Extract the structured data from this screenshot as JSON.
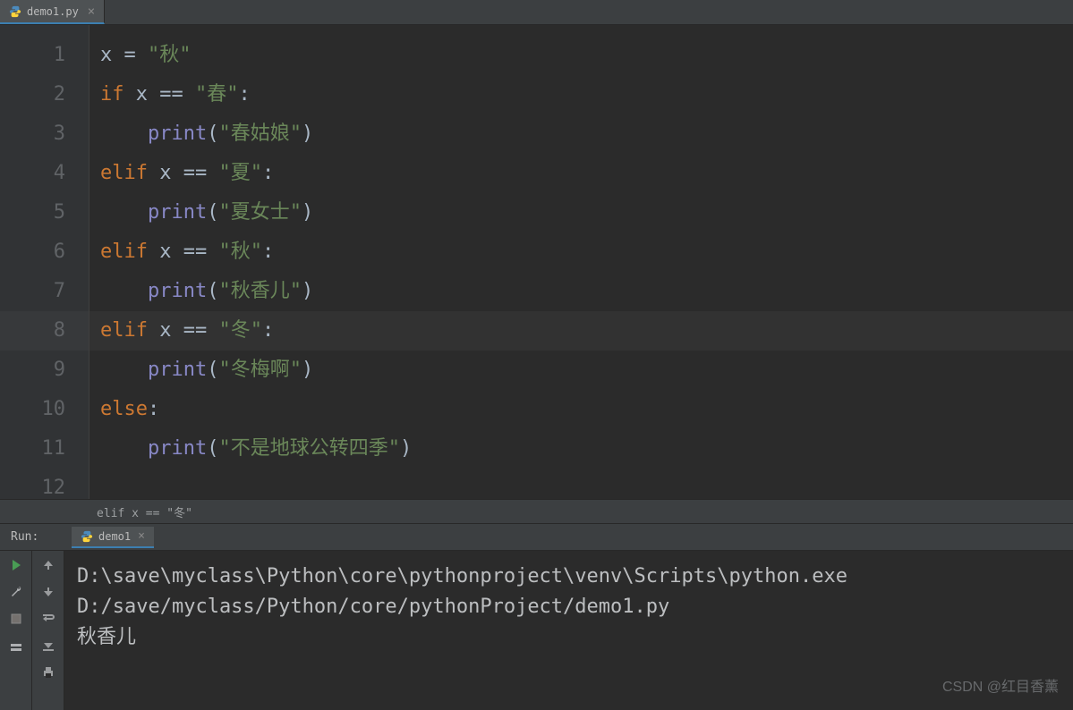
{
  "tab": {
    "filename": "demo1.py"
  },
  "gutter": [
    "1",
    "2",
    "3",
    "4",
    "5",
    "6",
    "7",
    "8",
    "9",
    "10",
    "11",
    "12"
  ],
  "code": {
    "l1": {
      "id1": "x",
      "op": " = ",
      "str": "\"秋\""
    },
    "l2": {
      "kw": "if",
      "id": " x ",
      "op": "==",
      "sp": " ",
      "str": "\"春\"",
      "col": ":"
    },
    "l3": {
      "pad": "    ",
      "fn": "print",
      "lp": "(",
      "str": "\"春姑娘\"",
      "rp": ")"
    },
    "l4": {
      "kw": "elif",
      "id": " x ",
      "op": "==",
      "sp": " ",
      "str": "\"夏\"",
      "col": ":"
    },
    "l5": {
      "pad": "    ",
      "fn": "print",
      "lp": "(",
      "str": "\"夏女士\"",
      "rp": ")"
    },
    "l6": {
      "kw": "elif",
      "id": " x ",
      "op": "==",
      "sp": " ",
      "str": "\"秋\"",
      "col": ":"
    },
    "l7": {
      "pad": "    ",
      "fn": "print",
      "lp": "(",
      "str": "\"秋香儿\"",
      "rp": ")"
    },
    "l8": {
      "kw": "elif",
      "id": " x ",
      "op": "==",
      "sp": " ",
      "str": "\"冬\"",
      "col": ":"
    },
    "l9": {
      "pad": "    ",
      "fn": "print",
      "lp": "(",
      "str": "\"冬梅啊\"",
      "rp": ")"
    },
    "l10": {
      "kw": "else",
      "col": ":"
    },
    "l11": {
      "pad": "    ",
      "fn": "print",
      "lp": "(",
      "str": "\"不是地球公转四季\"",
      "rp": ")"
    }
  },
  "crumb": "elif x == \"冬\"",
  "run": {
    "label": "Run:",
    "tab_name": "demo1"
  },
  "console": {
    "line1": "D:\\save\\myclass\\Python\\core\\pythonproject\\venv\\Scripts\\python.exe",
    "line2": " D:/save/myclass/Python/core/pythonProject/demo1.py",
    "line3": "秋香儿"
  },
  "watermark": "CSDN @红目香薰",
  "active_line": 8
}
